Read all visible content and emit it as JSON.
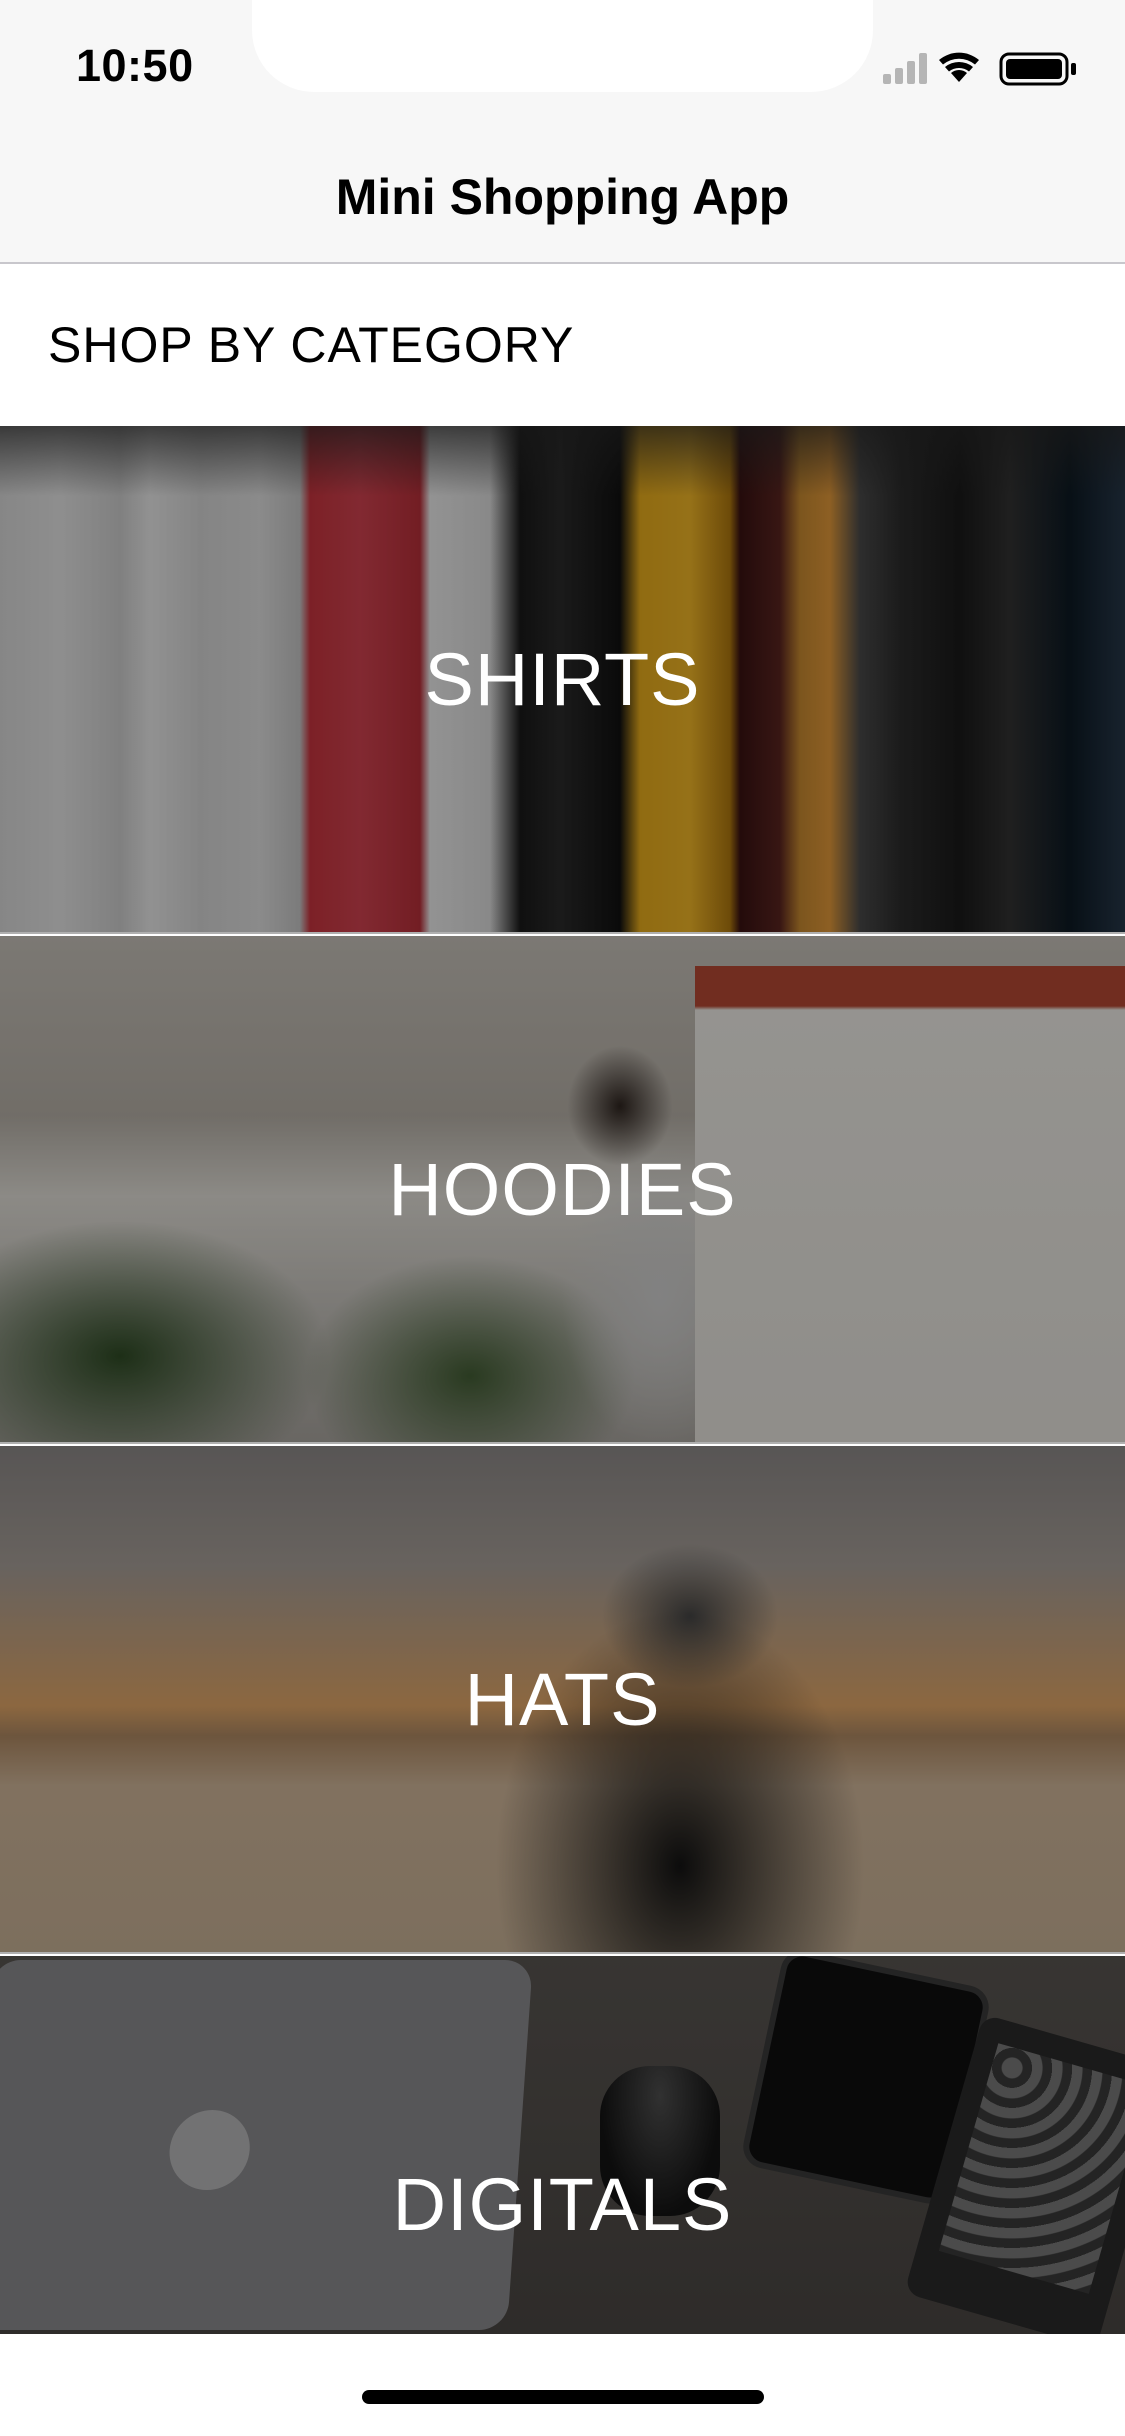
{
  "status_bar": {
    "time": "10:50",
    "icons": [
      "cellular-signal-icon",
      "wifi-icon",
      "battery-icon"
    ]
  },
  "nav": {
    "title": "Mini Shopping App"
  },
  "section": {
    "title": "SHOP BY CATEGORY"
  },
  "categories": [
    {
      "label": "SHIRTS",
      "image": "clothing-rack"
    },
    {
      "label": "HOODIES",
      "image": "man-in-hoodie-city"
    },
    {
      "label": "HATS",
      "image": "man-in-cap-sunset"
    },
    {
      "label": "DIGITALS",
      "image": "laptop-phone-camera-desk"
    }
  ],
  "colors": {
    "nav_background": "#f7f7f7",
    "overlay": "rgba(0,0,0,0.38)",
    "label_text": "#ffffff"
  }
}
